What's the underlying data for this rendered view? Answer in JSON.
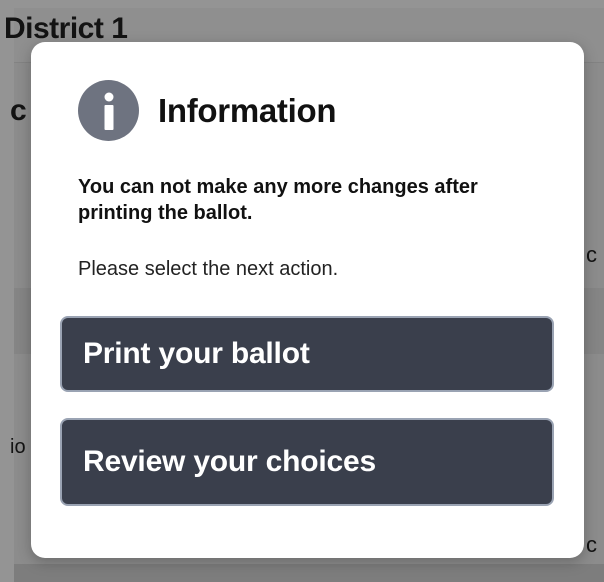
{
  "background": {
    "title": "District 1",
    "letter_left_top": "c",
    "letter_right_mid": "c",
    "letter_left_low": "io",
    "letter_right_low": "c"
  },
  "modal": {
    "icon": "info-icon",
    "title": "Information",
    "warning": "You can not make any more changes after printing the ballot.",
    "instruction": "Please select the next action.",
    "buttons": {
      "print": "Print your ballot",
      "review": "Review your choices"
    }
  },
  "colors": {
    "button_bg": "#3a3f4c",
    "button_border": "#9aa3b3",
    "icon_bg": "#6e7380",
    "overlay": "rgba(0,0,0,0.42)"
  }
}
